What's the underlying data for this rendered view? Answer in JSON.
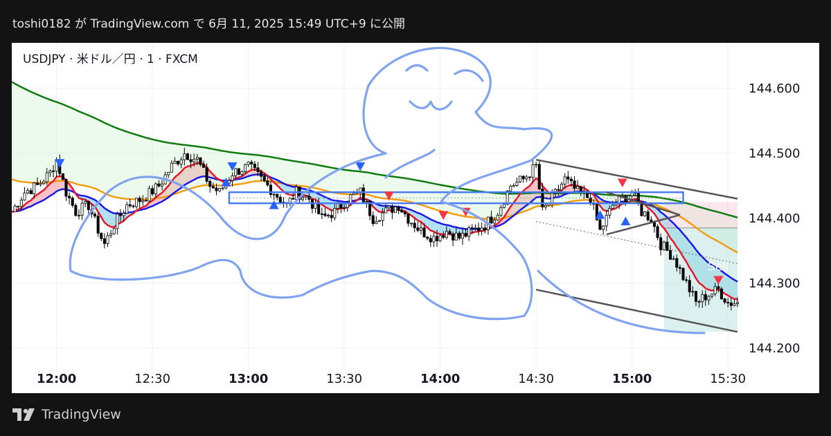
{
  "header": {
    "published": "toshi0182 が TradingView.com で 6月 11, 2025 15:49 UTC+9 に公開"
  },
  "symbol": {
    "label": "USDJPY · 米ドル／円 · 1 · FXCM"
  },
  "footer": {
    "brand": "TradingView",
    "logo_icon": "tradingview-logo-icon"
  },
  "colors": {
    "bg": "#131313",
    "panel": "#ffffff",
    "grid": "#f0f0f0",
    "up": "#ffffff",
    "down": "#000000",
    "wick": "#000000",
    "ma_red": "#e6192b",
    "ma_blue": "#1a1ae6",
    "ma_orange": "#f39c12",
    "ma_green": "#0f7a0f",
    "fill_pink": "#f7a8b0",
    "fill_cyan": "#8fd3ec",
    "fill_lightgreen": "#c8f0c8",
    "sketch": "#7fa3f0",
    "channel": "#555555",
    "tri_blue": "#2962ff",
    "tri_red": "#f23645",
    "pos_box": "#b2dfdb",
    "sell_label": "#ffffff"
  },
  "chart_data": {
    "type": "candlestick",
    "title": "",
    "x_axis_labels": [
      {
        "t": 0,
        "label": "12:00",
        "bold": true
      },
      {
        "t": 30,
        "label": "12:30",
        "bold": false
      },
      {
        "t": 60,
        "label": "13:00",
        "bold": true
      },
      {
        "t": 90,
        "label": "13:30",
        "bold": false
      },
      {
        "t": 120,
        "label": "14:00",
        "bold": true
      },
      {
        "t": 150,
        "label": "14:30",
        "bold": false
      },
      {
        "t": 180,
        "label": "15:00",
        "bold": true
      },
      {
        "t": 210,
        "label": "15:30",
        "bold": false
      }
    ],
    "y_ticks": [
      "144.600",
      "144.500",
      "144.400",
      "144.300",
      "144.200"
    ],
    "y_tick_values": [
      144.6,
      144.5,
      144.4,
      144.3,
      144.2
    ],
    "ylim": [
      144.17,
      144.67
    ],
    "x_range_minutes": [
      -14,
      213
    ],
    "grid": true,
    "close_path": [
      [
        -14,
        144.41
      ],
      [
        -10,
        144.44
      ],
      [
        -6,
        144.45
      ],
      [
        -2,
        144.47
      ],
      [
        0,
        144.49
      ],
      [
        3,
        144.44
      ],
      [
        6,
        144.41
      ],
      [
        10,
        144.42
      ],
      [
        14,
        144.37
      ],
      [
        15,
        144.36
      ],
      [
        18,
        144.39
      ],
      [
        22,
        144.42
      ],
      [
        27,
        144.43
      ],
      [
        32,
        144.45
      ],
      [
        36,
        144.48
      ],
      [
        40,
        144.5
      ],
      [
        44,
        144.49
      ],
      [
        48,
        144.45
      ],
      [
        51,
        144.44
      ],
      [
        55,
        144.47
      ],
      [
        60,
        144.48
      ],
      [
        64,
        144.46
      ],
      [
        68,
        144.44
      ],
      [
        72,
        144.42
      ],
      [
        75,
        144.44
      ],
      [
        79,
        144.43
      ],
      [
        83,
        144.4
      ],
      [
        87,
        144.41
      ],
      [
        91,
        144.43
      ],
      [
        95,
        144.44
      ],
      [
        99,
        144.4
      ],
      [
        103,
        144.41
      ],
      [
        107,
        144.42
      ],
      [
        110,
        144.4
      ],
      [
        114,
        144.38
      ],
      [
        118,
        144.37
      ],
      [
        122,
        144.38
      ],
      [
        126,
        144.37
      ],
      [
        130,
        144.38
      ],
      [
        134,
        144.39
      ],
      [
        138,
        144.41
      ],
      [
        142,
        144.45
      ],
      [
        146,
        144.46
      ],
      [
        150,
        144.48
      ],
      [
        152,
        144.41
      ],
      [
        155,
        144.43
      ],
      [
        159,
        144.46
      ],
      [
        163,
        144.44
      ],
      [
        167,
        144.43
      ],
      [
        170,
        144.38
      ],
      [
        174,
        144.42
      ],
      [
        177,
        144.43
      ],
      [
        180,
        144.44
      ],
      [
        183,
        144.41
      ],
      [
        186,
        144.4
      ],
      [
        189,
        144.36
      ],
      [
        193,
        144.34
      ],
      [
        197,
        144.3
      ],
      [
        200,
        144.27
      ],
      [
        203,
        144.28
      ],
      [
        207,
        144.29
      ],
      [
        210,
        144.27
      ],
      [
        213,
        144.27
      ]
    ],
    "sell_label": "Sell"
  }
}
